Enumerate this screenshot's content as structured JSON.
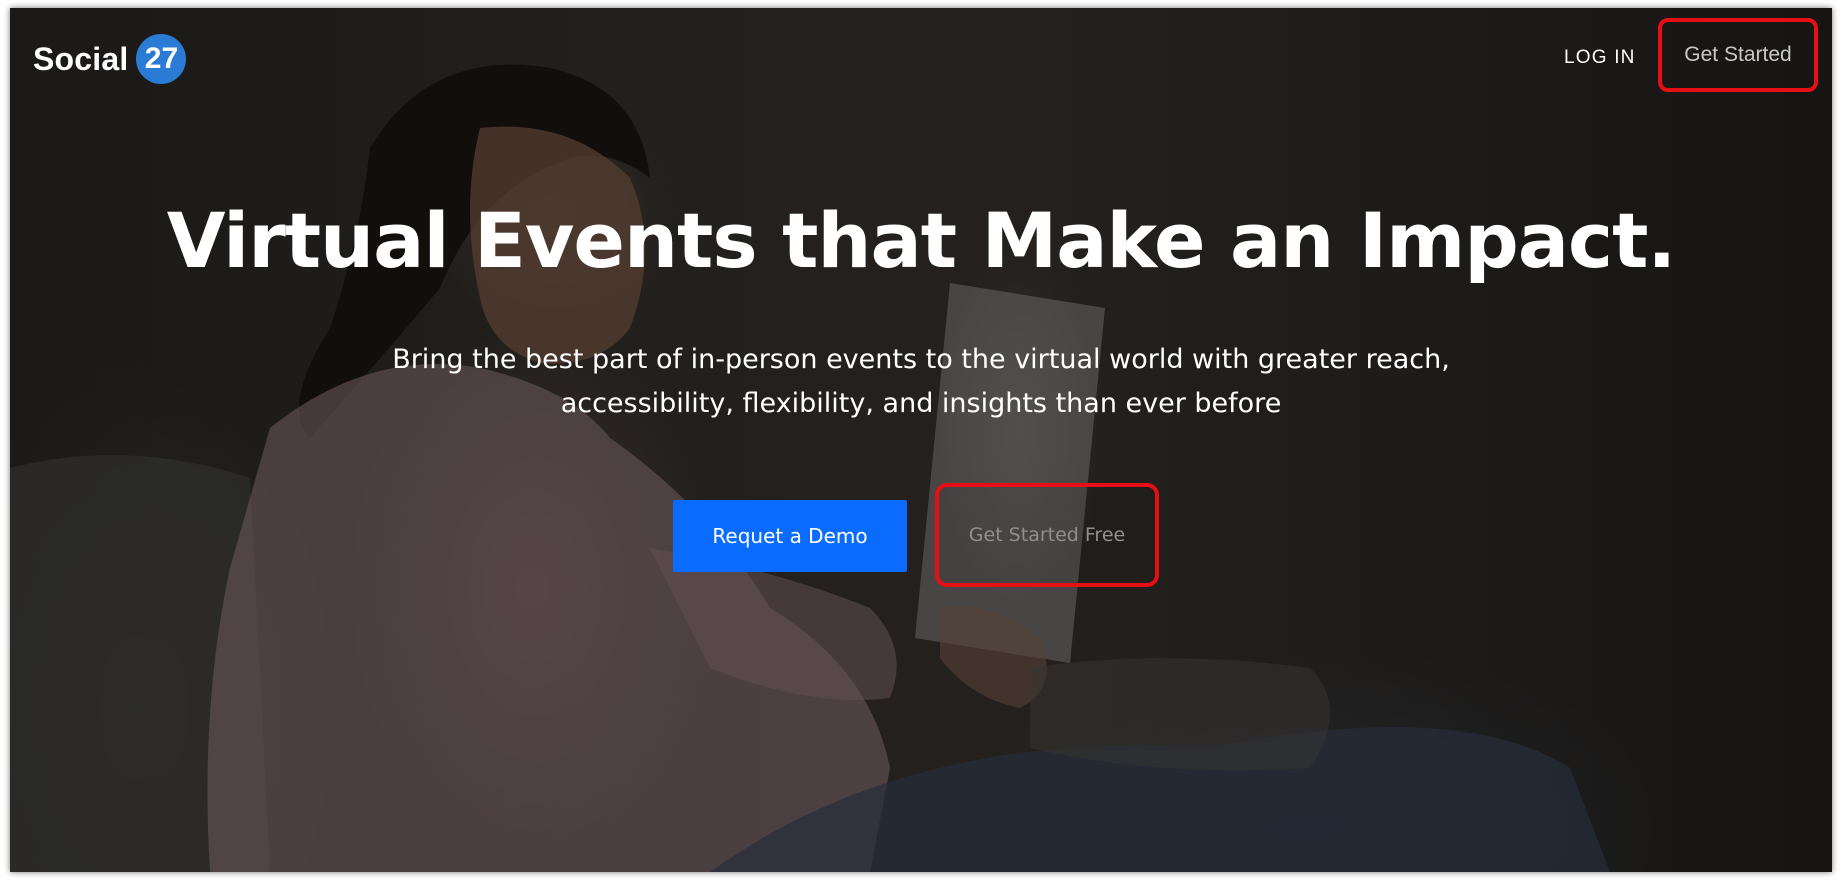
{
  "nav": {
    "logo_text": "Social",
    "logo_badge": "27",
    "login_label": "LOG IN",
    "get_started_label": "Get Started"
  },
  "hero": {
    "title": "Virtual Events that Make an Impact.",
    "subtitle": "Bring the best part of in-person events to the virtual world with greater reach, accessibility, flexibility, and insights than ever before",
    "primary_button": "Requet a Demo",
    "secondary_button": "Get Started Free"
  },
  "colors": {
    "brand_blue": "#2a7bd4",
    "cta_blue": "#0a6cff",
    "highlight_red": "#e60f14"
  }
}
